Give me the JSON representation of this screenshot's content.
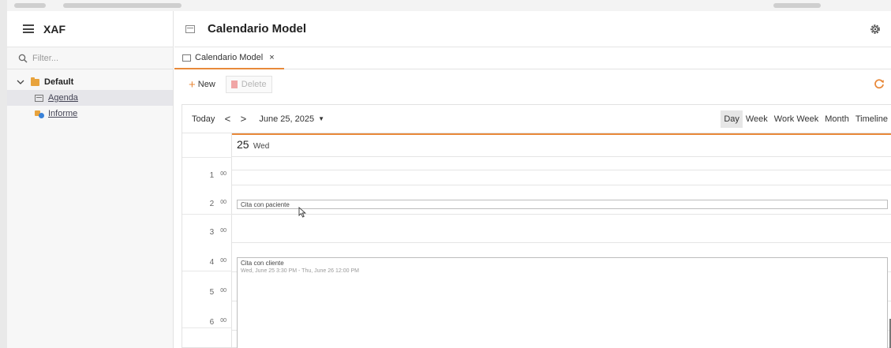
{
  "app": {
    "title": "XAF"
  },
  "sidebar": {
    "filter_placeholder": "Filter...",
    "group": {
      "label": "Default"
    },
    "items": [
      {
        "label": "Agenda",
        "selected": true
      },
      {
        "label": "Informe",
        "selected": false
      }
    ]
  },
  "header": {
    "title": "Calendario Model"
  },
  "tab": {
    "label": "Calendario Model",
    "close": "×"
  },
  "toolbar": {
    "new_label": "New",
    "delete_label": "Delete"
  },
  "scheduler": {
    "today_label": "Today",
    "prev": "<",
    "next": ">",
    "date_label": "June 25, 2025",
    "dropdown_glyph": "▼",
    "views": [
      "Day",
      "Week",
      "Work Week",
      "Month",
      "Timeline"
    ],
    "active_view": "Day",
    "day_number": "25",
    "day_name": "Wed",
    "hours": [
      {
        "h": "1",
        "m": "00"
      },
      {
        "h": "2",
        "m": "00"
      },
      {
        "h": "3",
        "m": "00"
      },
      {
        "h": "4",
        "m": "00"
      },
      {
        "h": "5",
        "m": "00"
      },
      {
        "h": "6",
        "m": "00"
      }
    ],
    "appointments": [
      {
        "subject": "Cita con paciente"
      },
      {
        "subject": "Cita con cliente",
        "time": "Wed, June 25 3:30 PM - Thu, June 26 12:00 PM"
      }
    ]
  },
  "colors": {
    "accent": "#e8893a",
    "folder": "#e8a33d",
    "report_blue": "#3a82d8"
  },
  "icons": [
    "hamburger-icon",
    "search-icon",
    "chevron-down-icon",
    "folder-icon",
    "calendar-icon",
    "report-icon",
    "list-view-icon",
    "gear-icon",
    "close-icon",
    "plus-icon",
    "trash-icon",
    "refresh-icon",
    "chevron-left-icon",
    "chevron-right-icon"
  ]
}
